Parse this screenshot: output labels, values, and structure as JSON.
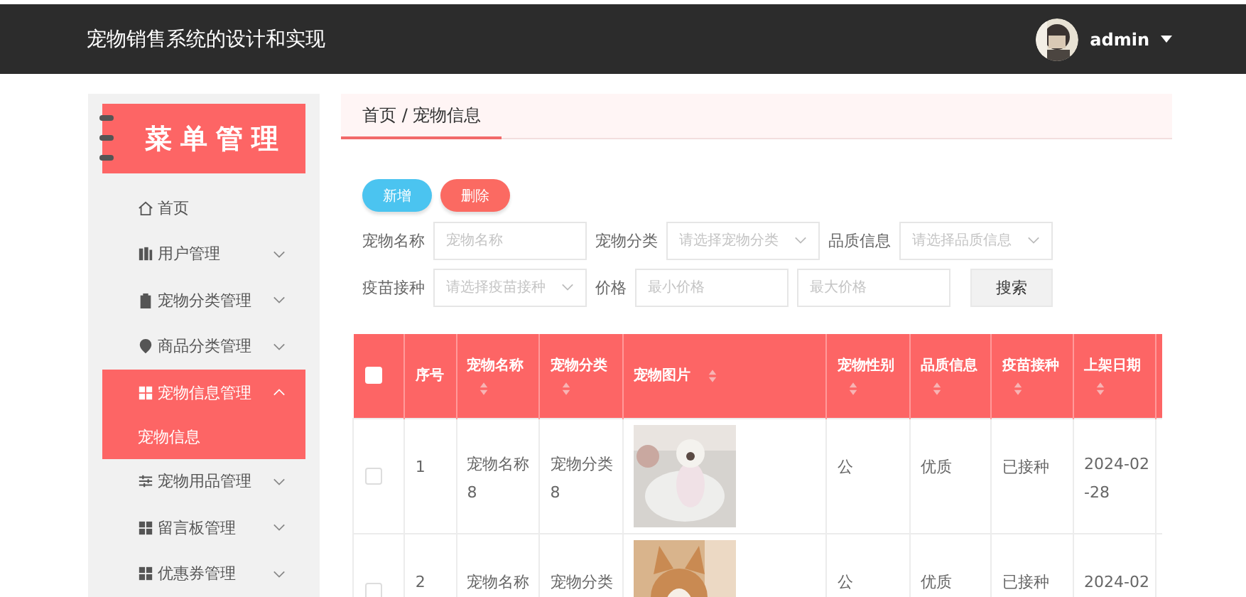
{
  "header": {
    "title": "宠物销售系统的设计和实现",
    "user": "admin"
  },
  "sidebar": {
    "title": "菜单管理",
    "items": [
      {
        "label": "首页",
        "expandable": false
      },
      {
        "label": "用户管理",
        "expandable": true,
        "expanded": false
      },
      {
        "label": "宠物分类管理",
        "expandable": true,
        "expanded": false
      },
      {
        "label": "商品分类管理",
        "expandable": true,
        "expanded": false
      },
      {
        "label": "宠物信息管理",
        "expandable": true,
        "expanded": true,
        "children": [
          {
            "label": "宠物信息",
            "selected": true
          }
        ]
      },
      {
        "label": "宠物用品管理",
        "expandable": true,
        "expanded": false
      },
      {
        "label": "留言板管理",
        "expandable": true,
        "expanded": false
      },
      {
        "label": "优惠券管理",
        "expandable": true,
        "expanded": false
      }
    ]
  },
  "breadcrumb": "首页 / 宠物信息",
  "buttons": [
    {
      "label": "新增",
      "kind": "add"
    },
    {
      "label": "删除",
      "kind": "delete"
    }
  ],
  "filter_rows": [
    [
      {
        "label": "宠物名称",
        "kind": "input",
        "placeholder": "宠物名称"
      },
      {
        "label": "宠物分类",
        "kind": "select",
        "placeholder": "请选择宠物分类"
      },
      {
        "label": "品质信息",
        "kind": "select",
        "placeholder": "请选择品质信息"
      }
    ],
    [
      {
        "label": "疫苗接种",
        "kind": "select",
        "placeholder": "请选择疫苗接种"
      },
      {
        "label": "价格",
        "kind": "input",
        "placeholder": "最小价格"
      },
      {
        "kind": "input",
        "placeholder": "最大价格"
      }
    ]
  ],
  "search_button": "搜索",
  "table": {
    "header_checked": false,
    "columns": [
      {
        "label": "序号",
        "sortable": false
      },
      {
        "label": "宠物名称",
        "sortable": true
      },
      {
        "label": "宠物分类",
        "sortable": true
      },
      {
        "label": "宠物图片",
        "sortable": true
      },
      {
        "label": "宠物性别",
        "sortable": true
      },
      {
        "label": "品质信息",
        "sortable": true
      },
      {
        "label": "疫苗接种",
        "sortable": true
      },
      {
        "label": "上架日期",
        "sortable": true
      }
    ],
    "rows": [
      {
        "checked": false,
        "cells": [
          "1",
          "宠物名称\n8",
          "宠物分类\n8",
          {
            "kind": "picture"
          },
          "公",
          "优质",
          "已接种",
          "2024-02\n-28"
        ]
      },
      {
        "checked": false,
        "cells": [
          "2",
          "宠物名称",
          "宠物分类",
          {
            "kind": "picture"
          },
          "公",
          "优质",
          "已接种",
          "2024-02"
        ]
      }
    ]
  }
}
